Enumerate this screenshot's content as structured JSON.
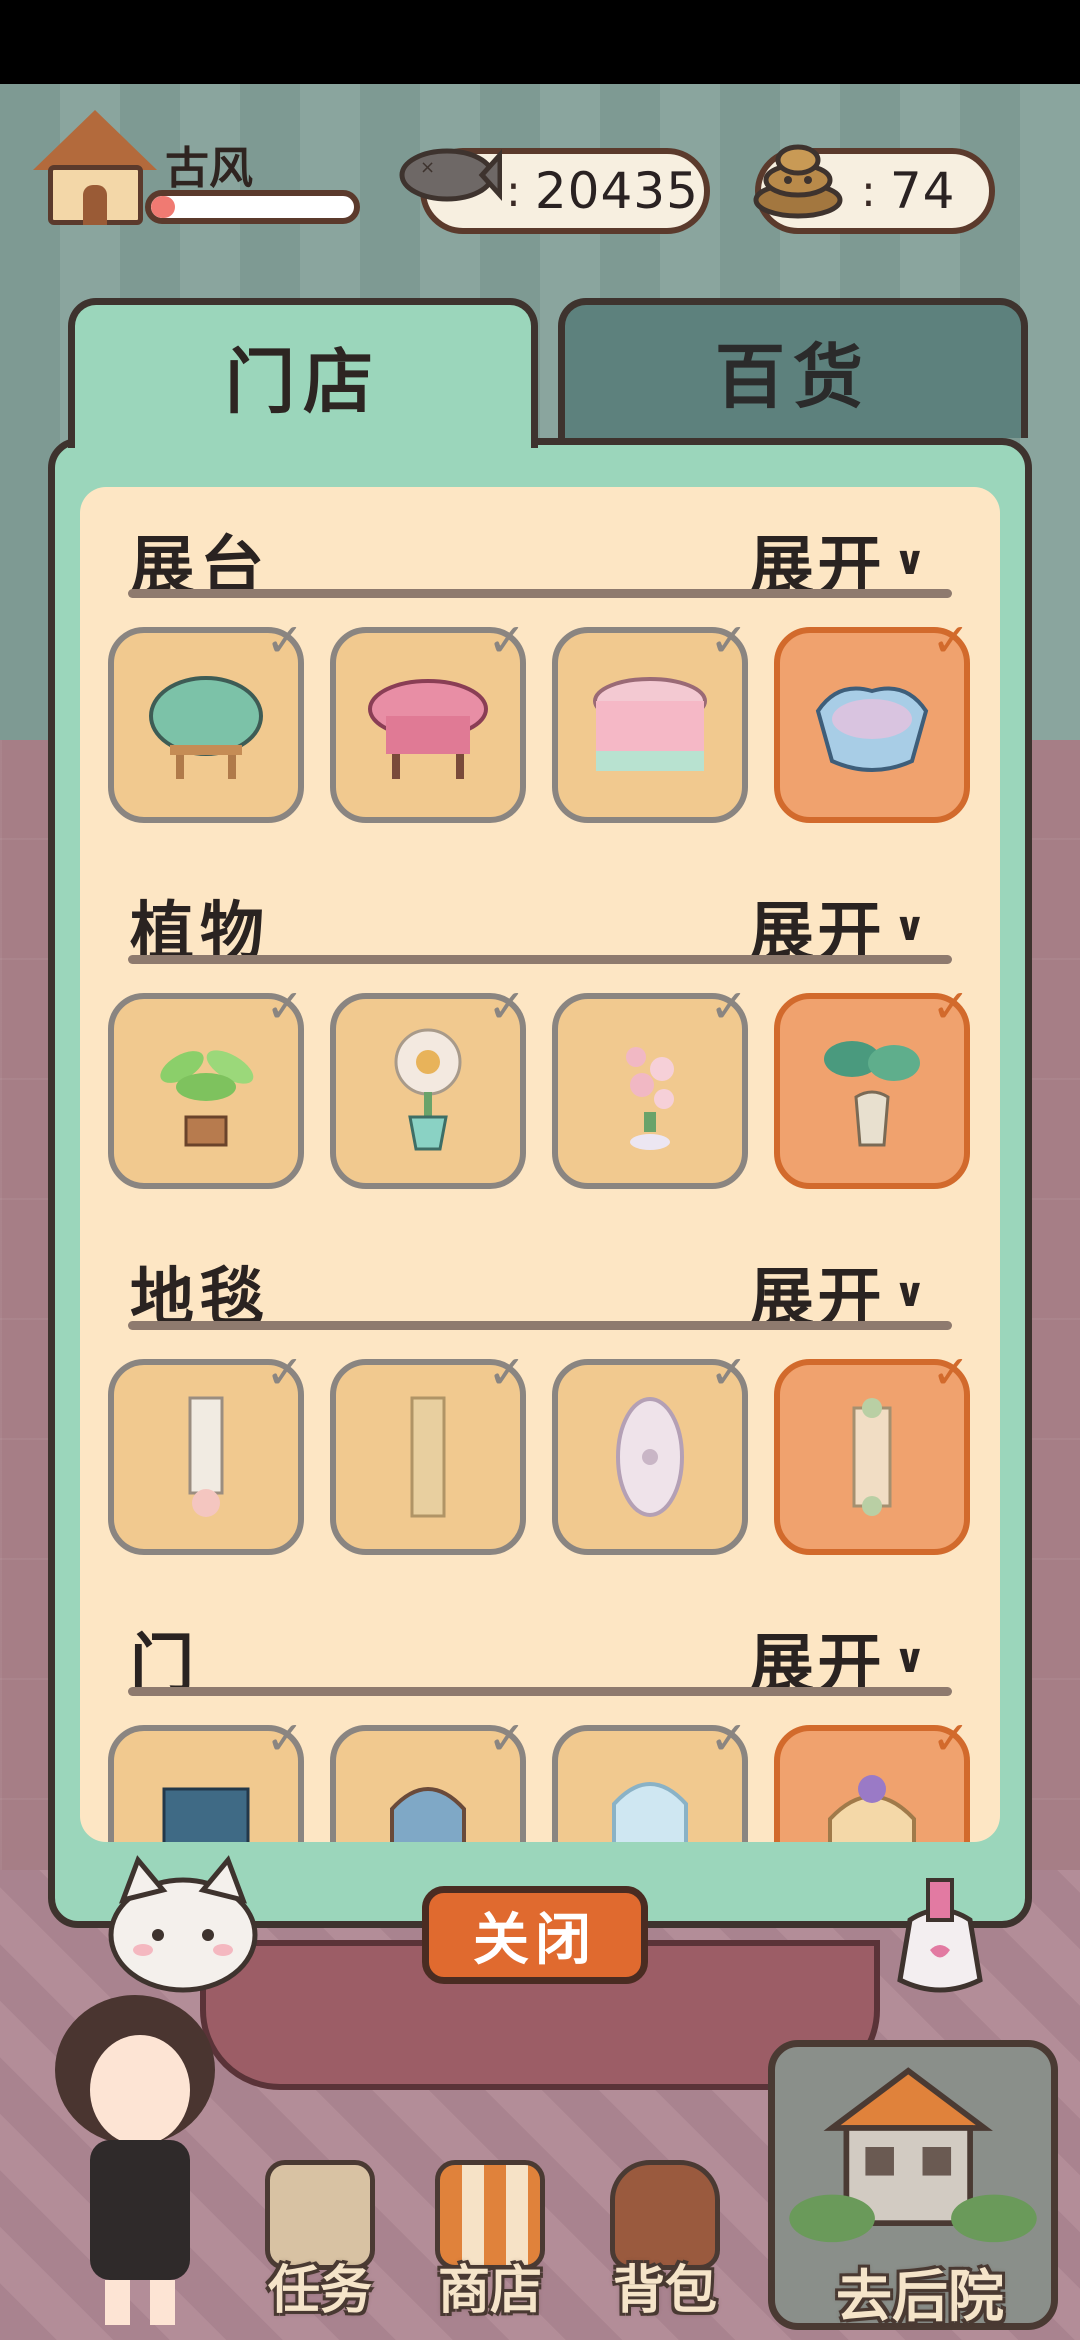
{
  "hud": {
    "level_name": "古风",
    "level_progress": 0.12,
    "fish_count": "20435",
    "poop_count": "74"
  },
  "tabs": [
    {
      "label": "门店",
      "active": true
    },
    {
      "label": "百货",
      "active": false
    }
  ],
  "sections": [
    {
      "title": "展台",
      "expand_label": "展开",
      "items": [
        {
          "icon": "green-cushion-stand",
          "selected": false
        },
        {
          "icon": "pink-quilted-stand",
          "selected": false
        },
        {
          "icon": "rainbow-tablecloth-stand",
          "selected": false
        },
        {
          "icon": "blue-scalloped-stand",
          "selected": true
        }
      ]
    },
    {
      "title": "植物",
      "expand_label": "展开",
      "items": [
        {
          "icon": "potted-leaf-plant",
          "selected": false
        },
        {
          "icon": "daisy-flower-vase",
          "selected": false
        },
        {
          "icon": "rose-bouquet-vase",
          "selected": false
        },
        {
          "icon": "monstera-vase",
          "selected": true
        }
      ]
    },
    {
      "title": "地毯",
      "expand_label": "展开",
      "items": [
        {
          "icon": "paw-runner-rug",
          "selected": false
        },
        {
          "icon": "beige-runner-rug",
          "selected": false
        },
        {
          "icon": "oval-cat-rug",
          "selected": false
        },
        {
          "icon": "ornate-runner-rug",
          "selected": true
        }
      ]
    },
    {
      "title": "门",
      "expand_label": "展开",
      "items": [
        {
          "icon": "blue-patterned-door",
          "selected": false
        },
        {
          "icon": "arched-curtain-door",
          "selected": false
        },
        {
          "icon": "glass-arch-door",
          "selected": false
        },
        {
          "icon": "flower-arch-door",
          "selected": true
        }
      ]
    }
  ],
  "close_label": "关闭",
  "bottom_nav": [
    {
      "label": "任务"
    },
    {
      "label": "商店"
    },
    {
      "label": "背包"
    },
    {
      "label": "去后院"
    }
  ],
  "colors": {
    "panel": "#9bd6bb",
    "panel_inner": "#fde6c4",
    "item_default": "#f1c98f",
    "item_selected": "#f0a26e",
    "close_button": "#e06a2f"
  }
}
